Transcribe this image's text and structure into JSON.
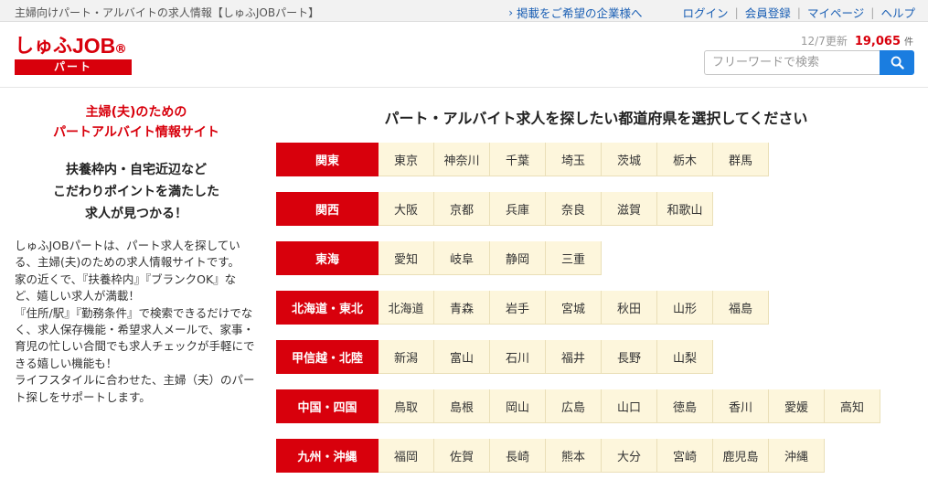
{
  "topbar": {
    "tagline": "主婦向けパート・アルバイトの求人情報【しゅふJOBパート】",
    "corporate_link": "掲載をご希望の企業様へ",
    "links": [
      "ログイン",
      "会員登録",
      "マイページ",
      "ヘルプ"
    ]
  },
  "logo": {
    "kana": "しゅふ",
    "job": "JOB",
    "reg": "R",
    "sub": "パート"
  },
  "stats": {
    "updated": "12/7更新",
    "count": "19,065",
    "unit": "件"
  },
  "search": {
    "placeholder": "フリーワードで検索",
    "icon": "search-icon"
  },
  "left": {
    "catch_line1": "主婦(夫)のための",
    "catch_line2": "パートアルバイト情報サイト",
    "sub_line1": "扶養枠内・自宅近辺など",
    "sub_line2": "こだわりポイントを満たした",
    "sub_line3": "求人が見つかる！",
    "desc": [
      "しゅふJOBパートは、パート求人を探している、主婦(夫)のための求人情報サイトです。",
      "家の近くで、『扶養枠内』『ブランクOK』など、嬉しい求人が満載！",
      "『住所/駅』『勤務条件』で検索できるだけでなく、求人保存機能・希望求人メールで、家事・育児の忙しい合間でも求人チェックが手軽にできる嬉しい機能も！",
      "ライフスタイルに合わせた、主婦（夫）のパート探しをサポートします。"
    ]
  },
  "main_title": "パート・アルバイト求人を探したい都道府県を選択してください",
  "colors": {
    "brand_red": "#d8000c",
    "link_blue": "#1a5fb4",
    "pref_bg": "#fdf6dc",
    "search_button": "#1a7de0"
  },
  "regions": [
    {
      "name": "関東",
      "prefs": [
        "東京",
        "神奈川",
        "千葉",
        "埼玉",
        "茨城",
        "栃木",
        "群馬"
      ]
    },
    {
      "name": "関西",
      "prefs": [
        "大阪",
        "京都",
        "兵庫",
        "奈良",
        "滋賀",
        "和歌山"
      ]
    },
    {
      "name": "東海",
      "prefs": [
        "愛知",
        "岐阜",
        "静岡",
        "三重"
      ]
    },
    {
      "name": "北海道・東北",
      "prefs": [
        "北海道",
        "青森",
        "岩手",
        "宮城",
        "秋田",
        "山形",
        "福島"
      ]
    },
    {
      "name": "甲信越・北陸",
      "prefs": [
        "新潟",
        "富山",
        "石川",
        "福井",
        "長野",
        "山梨"
      ]
    },
    {
      "name": "中国・四国",
      "prefs": [
        "鳥取",
        "島根",
        "岡山",
        "広島",
        "山口",
        "徳島",
        "香川",
        "愛媛",
        "高知"
      ]
    },
    {
      "name": "九州・沖縄",
      "prefs": [
        "福岡",
        "佐賀",
        "長崎",
        "熊本",
        "大分",
        "宮崎",
        "鹿児島",
        "沖縄"
      ]
    }
  ]
}
